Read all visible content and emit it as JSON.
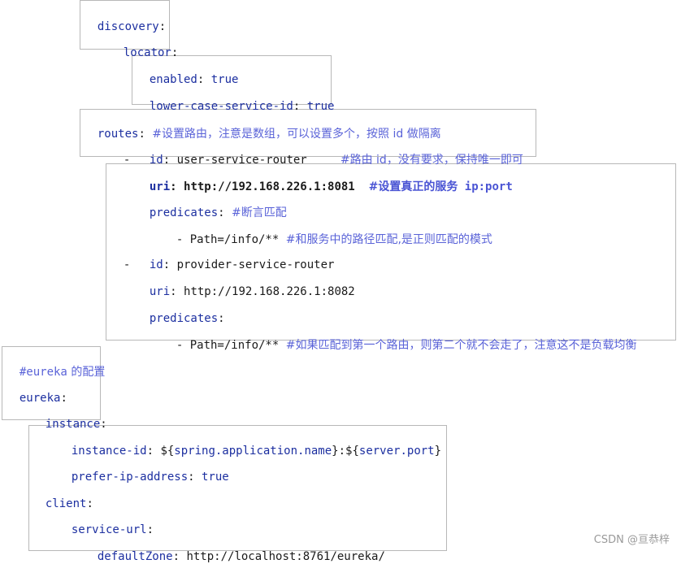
{
  "discovery": {
    "discovery_key": "discovery",
    "locator_key": "locator",
    "enabled_key": "enabled",
    "enabled_value": "true",
    "lower_case_key": "lower-case-service-id",
    "lower_case_value": "true"
  },
  "routes": {
    "routes_key": "routes",
    "routes_comment": "#设置路由，注意是数组，可以设置多个，按照 id 做隔离",
    "route1": {
      "dash": "-",
      "id_key": "id",
      "id_value": "user-service-router",
      "id_comment": "#路由 id，没有要求，保持唯一即可",
      "uri_key": "uri",
      "uri_value": "http://192.168.226.1:8081",
      "uri_comment_cn": "#设置真正的服务",
      "uri_comment_code": "ip:port",
      "predicates_key": "predicates",
      "predicates_comment": "#断言匹配",
      "path_item": "- Path=/info/**",
      "path_comment": "#和服务中的路径匹配,是正则匹配的模式"
    },
    "route2": {
      "dash": "-",
      "id_key": "id",
      "id_value": "provider-service-router",
      "uri_key": "uri",
      "uri_value": "http://192.168.226.1:8082",
      "predicates_key": "predicates",
      "path_item": "- Path=/info/**",
      "path_comment": "#如果匹配到第一个路由，则第二个就不会走了，注意这不是负载均衡"
    }
  },
  "eureka": {
    "section_comment_code": "#eureka",
    "section_comment_cn": "的配置",
    "eureka_key": "eureka",
    "instance_key": "instance",
    "instance_id_key": "instance-id",
    "instance_id_prefix": "${",
    "instance_id_ref1": "spring.application.name",
    "instance_id_mid": "}:${",
    "instance_id_ref2": "server.port",
    "instance_id_suffix": "}",
    "prefer_ip_key": "prefer-ip-address",
    "prefer_ip_value": "true",
    "client_key": "client",
    "service_url_key": "service-url",
    "default_zone_key": "defaultZone",
    "default_zone_value": "http://localhost:8761/eureka/"
  },
  "watermark": "CSDN @亘恭梓",
  "colors": {
    "key": "#1c2fa0",
    "comment": "#5a63d8",
    "border": "#b8b8b8"
  }
}
